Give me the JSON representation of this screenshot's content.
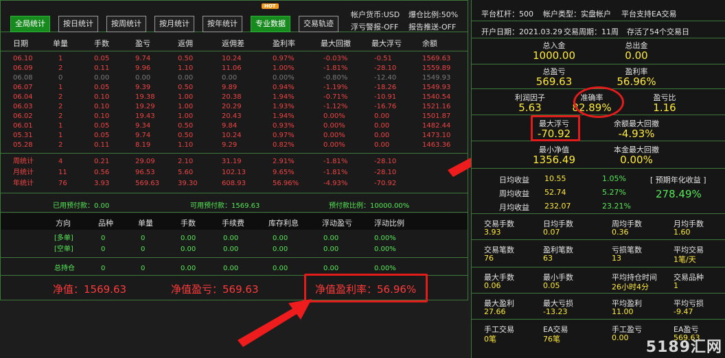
{
  "toolbar": {
    "buttons": [
      "全局统计",
      "按日统计",
      "按周统计",
      "按月统计",
      "按年统计",
      "专业数据",
      "交易轨迹"
    ],
    "hot": "HOT",
    "currency": "帐户货币:USD",
    "leverage_ratio": "爆仓比例:50%",
    "float_alert": "浮亏警报-OFF",
    "report_push": "报告推送-OFF"
  },
  "table": {
    "headers": [
      "日期",
      "单量",
      "手数",
      "盈亏",
      "返佣",
      "返佣差",
      "盈利率",
      "最大回撤",
      "最大浮亏",
      "余额"
    ],
    "rows": [
      [
        "06.10",
        "1",
        "0.05",
        "9.74",
        "0.50",
        "10.24",
        "0.97%",
        "-0.03%",
        "-0.51",
        "1569.63"
      ],
      [
        "06.09",
        "2",
        "0.11",
        "9.96",
        "1.10",
        "11.06",
        "1.00%",
        "-1.81%",
        "-28.10",
        "1559.89"
      ],
      [
        "06.08",
        "0",
        "0.00",
        "0.00",
        "0.00",
        "0.00",
        "0.00%",
        "-0.80%",
        "-12.40",
        "1549.93"
      ],
      [
        "06.07",
        "1",
        "0.05",
        "9.39",
        "0.50",
        "9.89",
        "0.94%",
        "-1.19%",
        "-18.26",
        "1549.93"
      ],
      [
        "06.04",
        "2",
        "0.10",
        "19.38",
        "1.00",
        "20.38",
        "1.94%",
        "-0.71%",
        "-10.91",
        "1540.54"
      ],
      [
        "06.03",
        "2",
        "0.10",
        "19.29",
        "1.00",
        "20.29",
        "1.93%",
        "-1.12%",
        "-16.76",
        "1521.16"
      ],
      [
        "06.02",
        "2",
        "0.10",
        "19.43",
        "1.00",
        "20.43",
        "1.94%",
        "0.00%",
        "0.00",
        "1501.87"
      ],
      [
        "06.01",
        "1",
        "0.05",
        "9.34",
        "0.50",
        "9.84",
        "0.93%",
        "0.00%",
        "0.00",
        "1482.44"
      ],
      [
        "05.31",
        "1",
        "0.05",
        "9.74",
        "0.50",
        "10.24",
        "0.97%",
        "0.00%",
        "0.00",
        "1473.10"
      ],
      [
        "05.28",
        "2",
        "0.11",
        "8.19",
        "1.10",
        "9.29",
        "0.82%",
        "0.00%",
        "0.00",
        "1463.36"
      ]
    ],
    "summary": [
      [
        "周统计",
        "4",
        "0.21",
        "29.09",
        "2.10",
        "31.19",
        "2.91%",
        "-1.81%",
        "-28.10",
        ""
      ],
      [
        "月统计",
        "11",
        "0.56",
        "96.53",
        "5.60",
        "102.13",
        "9.65%",
        "-1.81%",
        "-28.10",
        ""
      ],
      [
        "年统计",
        "76",
        "3.93",
        "569.63",
        "39.30",
        "608.93",
        "56.96%",
        "-4.93%",
        "-70.92",
        ""
      ]
    ]
  },
  "prepay": {
    "used": "已用预付款：0.00",
    "available": "可用预付款：1569.63",
    "ratio": "预付款比例：10000.00%"
  },
  "positions": {
    "headers": [
      "方向",
      "品种",
      "单量",
      "手数",
      "手续费",
      "库存利息",
      "浮动盈亏",
      "浮动比例"
    ],
    "rows": [
      [
        "[多单]",
        "0",
        "0",
        "0.00",
        "0.00",
        "0.00",
        "0.00",
        "0.00%"
      ],
      [
        "[空单]",
        "0",
        "0",
        "0.00",
        "0.00",
        "0.00",
        "0.00",
        "0.00%"
      ]
    ],
    "total": [
      "总持仓",
      "0",
      "0",
      "0.00",
      "0.00",
      "0.00",
      "0.00",
      "0.00%"
    ]
  },
  "footer": {
    "net": "净值：1569.63",
    "net_pl": "净值盈亏：569.63",
    "net_rate": "净值盈利率：56.96%"
  },
  "right": {
    "top1": [
      "平台杠杆：500",
      "帐户类型：实盘帐户",
      "平台支持EA交易"
    ],
    "top2": [
      "开户日期：2021.03.29",
      "交易周期：11周",
      "存活了54个交易日"
    ],
    "total_deposit_lbl": "总入金",
    "total_deposit": "1000.00",
    "total_withdraw_lbl": "总出金",
    "total_withdraw": "0.00",
    "total_pl_lbl": "总盈亏",
    "total_pl": "569.63",
    "profit_rate_lbl": "盈利率",
    "profit_rate": "56.96%",
    "profit_factor_lbl": "利润因子",
    "profit_factor": "5.63",
    "accuracy_lbl": "准确率",
    "accuracy": "82.89%",
    "pl_ratio_lbl": "盈亏比",
    "pl_ratio": "1.16",
    "max_float_lbl": "最大浮亏",
    "max_float": "-70.92",
    "bal_dd_lbl": "余额最大回撤",
    "bal_dd": "-4.93%",
    "min_net_lbl": "最小净值",
    "min_net": "1356.49",
    "principal_dd_lbl": "本金最大回撤",
    "principal_dd": "0.00%",
    "daily_lbl": "日均收益",
    "daily": "10.55",
    "daily_pct": "1.05%",
    "weekly_lbl": "周均收益",
    "weekly": "52.74",
    "weekly_pct": "5.27%",
    "monthly_lbl": "月均收益",
    "monthly": "232.07",
    "monthly_pct": "23.21%",
    "annual_lbl": "[ 预期年化收益 ]",
    "annual": "278.49%",
    "g1": [
      [
        "交易手数",
        "3.93"
      ],
      [
        "日均手数",
        "0.07"
      ],
      [
        "周均手数",
        "0.36"
      ],
      [
        "月均手数",
        "1.60"
      ]
    ],
    "g2": [
      [
        "交易笔数",
        "76"
      ],
      [
        "盈利笔数",
        "63"
      ],
      [
        "亏损笔数",
        "13"
      ],
      [
        "平均交易",
        "1笔/天"
      ]
    ],
    "g3": [
      [
        "最大手数",
        "0.06"
      ],
      [
        "最小手数",
        "0.05"
      ],
      [
        "平均持仓时间",
        "26小时4分"
      ],
      [
        "交易品种",
        "1"
      ]
    ],
    "g4": [
      [
        "最大盈利",
        "27.66"
      ],
      [
        "最大亏损",
        "-13.23"
      ],
      [
        "平均盈利",
        "11.00"
      ],
      [
        "平均亏损",
        "-9.47"
      ]
    ],
    "g5": [
      [
        "手工交易",
        "0笔"
      ],
      [
        "EA交易",
        "76笔"
      ],
      [
        "手工盈亏",
        "0.00"
      ],
      [
        "EA盈亏",
        "569.63"
      ]
    ]
  },
  "watermark": "5189汇网"
}
